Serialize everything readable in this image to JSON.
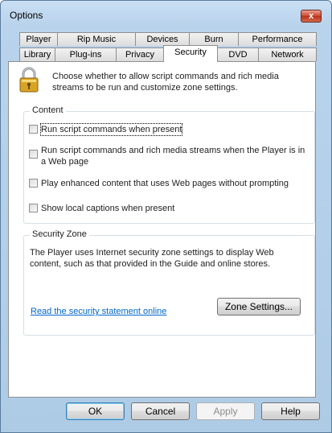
{
  "window": {
    "title": "Options",
    "close_label": "x"
  },
  "tabs_row1": [
    {
      "label": "Player"
    },
    {
      "label": "Rip Music"
    },
    {
      "label": "Devices"
    },
    {
      "label": "Burn"
    },
    {
      "label": "Performance"
    }
  ],
  "tabs_row2": [
    {
      "label": "Library"
    },
    {
      "label": "Plug-ins"
    },
    {
      "label": "Privacy"
    },
    {
      "label": "Security",
      "active": true
    },
    {
      "label": "DVD"
    },
    {
      "label": "Network"
    }
  ],
  "intro_text": "Choose whether to allow script commands and rich media streams to be run and customize zone settings.",
  "content": {
    "legend": "Content",
    "options": [
      {
        "label": "Run script commands when present",
        "checked": false
      },
      {
        "label": "Run script commands and rich media streams when the Player is in a Web page",
        "checked": false
      },
      {
        "label": "Play enhanced content that uses Web pages without prompting",
        "checked": false
      },
      {
        "label": "Show local captions when present",
        "checked": false
      }
    ]
  },
  "zone": {
    "legend": "Security Zone",
    "description": "The Player uses Internet security zone settings to display Web content, such as that provided in the Guide and online stores.",
    "link": "Read the security statement online",
    "button": "Zone Settings..."
  },
  "buttons": {
    "ok": "OK",
    "cancel": "Cancel",
    "apply": "Apply",
    "help": "Help"
  },
  "icons": {
    "lock": "lock-icon",
    "close": "close-icon"
  }
}
